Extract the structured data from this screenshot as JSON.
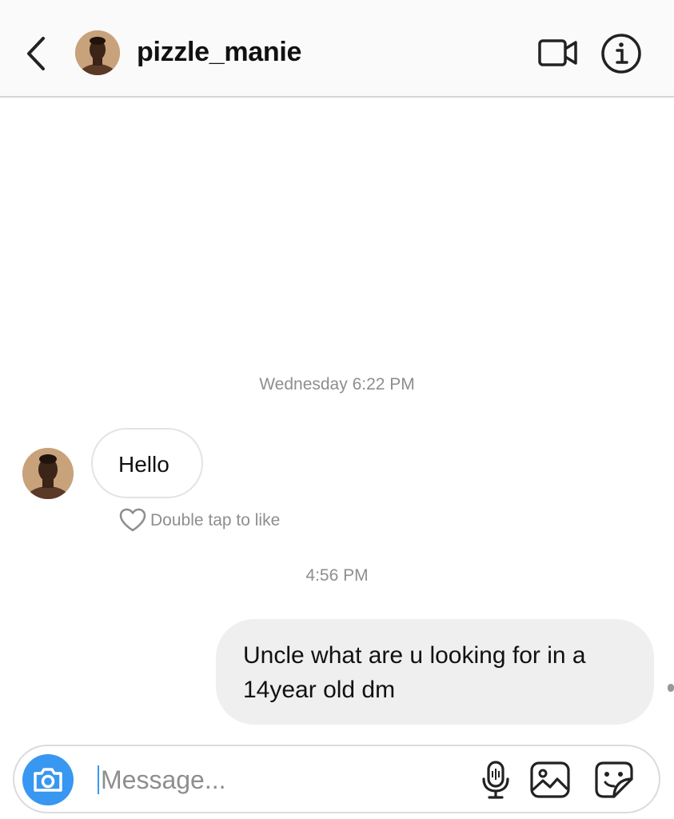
{
  "header": {
    "username": "pizzle_manie",
    "icons": {
      "back": "chevron-left-icon",
      "video": "video-camera-icon",
      "info": "info-icon"
    }
  },
  "thread": {
    "timestamps": [
      "Wednesday 6:22 PM",
      "4:56 PM"
    ],
    "incoming": {
      "text": "Hello",
      "like_hint": "Double tap to like"
    },
    "outgoing": {
      "text": "Uncle what are u looking for in a 14year old dm"
    }
  },
  "composer": {
    "placeholder": "Message...",
    "value": "",
    "icons": [
      "camera-icon",
      "microphone-icon",
      "gallery-icon",
      "sticker-icon"
    ]
  },
  "colors": {
    "accent": "#3897f0",
    "header_bg": "#fafafa",
    "outgoing_bubble": "#efefef",
    "muted_text": "#8e8e8e"
  }
}
